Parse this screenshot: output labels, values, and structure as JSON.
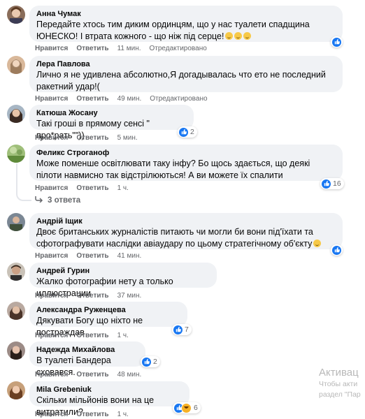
{
  "actions": {
    "like": "Нравится",
    "reply": "Ответить"
  },
  "comments": [
    {
      "author": "Анна Чумак",
      "text": "Передайте хтось тим диким ординцям, що у нас туалети спадщина ЮНЕСКО! І втрата кожного - що ніж під серце!",
      "emoji_count": 3,
      "time": "11 мин.",
      "edited": "Отредактировано",
      "reaction_count": ""
    },
    {
      "author": "Лера Павлова",
      "text": "Лично я не удивлена абсолютно,Я догадывалась что ето не последний ракетний удар!(",
      "time": "49 мин.",
      "edited": "Отредактировано",
      "reaction_count": ""
    },
    {
      "author": "Катюша Жосану",
      "text": "Такі гроші в прямому сенсі \" про*рать\"\"))",
      "time": "5 мин.",
      "edited": "",
      "reaction_count": "2"
    },
    {
      "author": "Феликс Строганоф",
      "text": "Може поменше освітлювати таку інфу? Бо щось здається, що деякі пілоти навмисно так відстрілюються! А ви можете їх спалити",
      "time": "1 ч.",
      "edited": "",
      "reaction_count": "16"
    },
    {
      "author": "Андрій Іщик",
      "text": "Двоє британських журналістів питають чи могли би вони під'їхати та сфотографувати наслідки авіаудару по цьому стратегічному об'єкту",
      "time": "41 мин.",
      "edited": "",
      "reaction_count": ""
    },
    {
      "author": "Андрей Гурин",
      "text": "Жалко фотографии нету а только иллюстрации",
      "time": "37 мин.",
      "edited": "",
      "reaction_count": ""
    },
    {
      "author": "Александра Руженцева",
      "text": "Дякувати Богу що ніхто не постраждав",
      "time": "1 ч.",
      "edited": "",
      "reaction_count": "7"
    },
    {
      "author": "Надежда Михайлова",
      "text": "В туалеті Бандера сховався.",
      "time": "48 мин.",
      "edited": "",
      "reaction_count": "2"
    },
    {
      "author": "Mila Grebeniuk",
      "text": "Скільки мільйонів вони на це витратили?",
      "time": "1 ч.",
      "edited": "",
      "reaction_count": "6"
    }
  ],
  "replies_link": "3 ответа",
  "watermark": {
    "line1": "Активац",
    "line2": "Чтобы акти",
    "line3": "раздел \"Пар"
  },
  "colors": {
    "bubble": "#f0f2f5",
    "like": "#1877f2",
    "haha": "#f7b125",
    "meta": "#65676b"
  }
}
